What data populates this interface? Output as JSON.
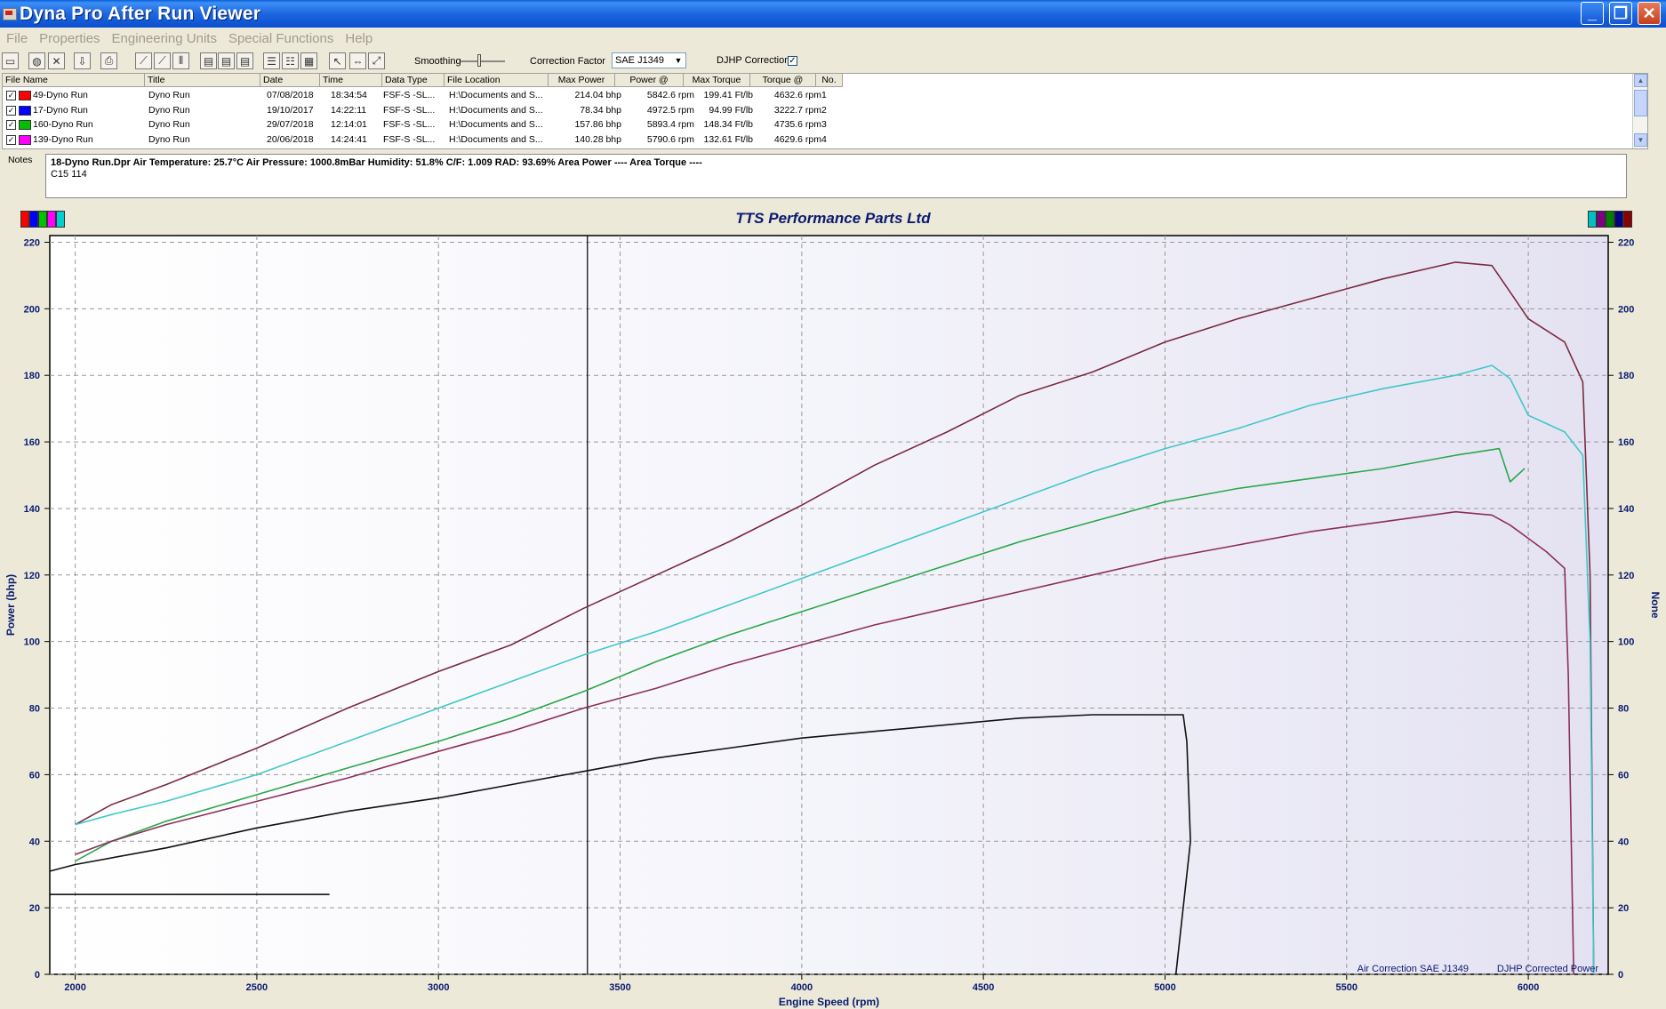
{
  "window": {
    "title": "Dyna Pro After Run Viewer",
    "minimize_glyph": "_",
    "maximize_glyph": "❐",
    "close_glyph": "✕"
  },
  "menu": [
    "File",
    "Properties",
    "Engineering Units",
    "Special Functions",
    "Help"
  ],
  "toolbar": {
    "smoothing_label": "Smoothing",
    "correction_factor_label": "Correction Factor",
    "correction_factor_value": "SAE J1349",
    "djhp_label": "DJHP Correction",
    "djhp_checked": "✓",
    "icons": [
      "open-icon",
      "globe-icon",
      "close-file-icon",
      "export-icon",
      "print-icon",
      "graph-icon",
      "graph-zoom-icon",
      "graph-compare-icon",
      "chart-icon",
      "chart-add-icon",
      "chart-settings-icon",
      "table-icon",
      "table-alt-icon",
      "table-grid-icon",
      "cursor-icon",
      "zoom-icon",
      "fit-icon"
    ],
    "icon_glyphs": [
      "▭",
      "◍",
      "✕",
      "⇩",
      "⎙",
      "⟋",
      "⟋",
      "⫴",
      "▤",
      "▤",
      "▤",
      "☰",
      "☷",
      "▦",
      "↖",
      "⇔",
      "⤢"
    ]
  },
  "file_table": {
    "headers": [
      "File Name",
      "Title",
      "Date",
      "Time",
      "Data Type",
      "File Location",
      "Max Power",
      "Power @",
      "Max Torque",
      "Torque @",
      "No."
    ],
    "check_glyph": "✓",
    "rows": [
      {
        "color": "#ff0000",
        "file": "49-Dyno Run",
        "title": "Dyno Run",
        "date": "07/08/2018",
        "time": "18:34:54",
        "type": "FSF-S -SL...",
        "location": "H:\\Documents and S...",
        "max_power": "214.04 bhp",
        "power_at": "5842.6 rpm",
        "max_torque": "199.41 Ft/lb",
        "torque_at": "4632.6 rpm",
        "no": "1"
      },
      {
        "color": "#0000ff",
        "file": "17-Dyno Run",
        "title": "Dyno Run",
        "date": "19/10/2017",
        "time": "14:22:11",
        "type": "FSF-S -SL...",
        "location": "H:\\Documents and S...",
        "max_power": "78.34 bhp",
        "power_at": "4972.5 rpm",
        "max_torque": "94.99 Ft/lb",
        "torque_at": "3222.7 rpm",
        "no": "2"
      },
      {
        "color": "#00c000",
        "file": "160-Dyno Run",
        "title": "Dyno Run",
        "date": "29/07/2018",
        "time": "12:14:01",
        "type": "FSF-S -SL...",
        "location": "H:\\Documents and S...",
        "max_power": "157.86 bhp",
        "power_at": "5893.4 rpm",
        "max_torque": "148.34 Ft/lb",
        "torque_at": "4735.6 rpm",
        "no": "3"
      },
      {
        "color": "#ff00ff",
        "file": "139-Dyno Run",
        "title": "Dyno Run",
        "date": "20/06/2018",
        "time": "14:24:41",
        "type": "FSF-S -SL...",
        "location": "H:\\Documents and S...",
        "max_power": "140.28 bhp",
        "power_at": "5790.6 rpm",
        "max_torque": "132.61 Ft/lb",
        "torque_at": "4629.6 rpm",
        "no": "4"
      }
    ]
  },
  "notes": {
    "label": "Notes",
    "line1": "18-Dyno Run.Dpr   Air Temperature: 25.7°C    Air Pressure: 1000.8mBar    Humidity: 51.8%    C/F: 1.009    RAD: 93.69%   Area Power ----    Area Torque ----",
    "line2": "C15 114"
  },
  "legend_swatches_left": [
    "#ff0000",
    "#0000ff",
    "#00c000",
    "#ff00ff",
    "#00d0d0"
  ],
  "legend_swatches_right": [
    "#00c0c0",
    "#800080",
    "#008000",
    "#000080",
    "#8b0000"
  ],
  "chart_data": {
    "type": "line",
    "title": "TTS Performance Parts Ltd",
    "xlabel": "Engine Speed (rpm)",
    "ylabel": "Power (bhp)",
    "ylabel_right": "None",
    "footer_left": "Air Correction SAE J1349",
    "footer_right": "DJHP Corrected Power",
    "xlim": [
      1930,
      6220
    ],
    "ylim": [
      0,
      222
    ],
    "xticks": [
      2000,
      2500,
      3000,
      3500,
      4000,
      4500,
      5000,
      5500,
      6000
    ],
    "yticks": [
      0,
      20,
      40,
      60,
      80,
      100,
      120,
      140,
      160,
      180,
      200,
      220
    ],
    "grid": true,
    "cursor_x": 3410,
    "reference_line": {
      "x": [
        1930,
        2700
      ],
      "y": 24
    },
    "series": [
      {
        "color": "#7a2b3f",
        "x": [
          2000,
          2100,
          2250,
          2500,
          2750,
          3000,
          3200,
          3400,
          3600,
          3800,
          4000,
          4200,
          4400,
          4600,
          4800,
          5000,
          5200,
          5400,
          5600,
          5800,
          5900,
          5950,
          6000,
          6100,
          6150,
          6170,
          6180
        ],
        "y": [
          45,
          51,
          57,
          68,
          80,
          91,
          99,
          110,
          120,
          130,
          141,
          153,
          163,
          174,
          181,
          190,
          197,
          203,
          209,
          214,
          213,
          205,
          197,
          190,
          178,
          120,
          0
        ]
      },
      {
        "color": "#40c8c8",
        "x": [
          2000,
          2100,
          2250,
          2500,
          2750,
          3000,
          3200,
          3400,
          3600,
          3800,
          4000,
          4200,
          4400,
          4600,
          4800,
          5000,
          5200,
          5400,
          5600,
          5800,
          5900,
          5950,
          6000,
          6100,
          6150,
          6170,
          6180
        ],
        "y": [
          45,
          48,
          52,
          60,
          70,
          80,
          88,
          96,
          103,
          111,
          119,
          127,
          135,
          143,
          151,
          158,
          164,
          171,
          176,
          180,
          183,
          179,
          168,
          163,
          156,
          100,
          0
        ]
      },
      {
        "color": "#2aa84a",
        "x": [
          2000,
          2100,
          2250,
          2500,
          2750,
          3000,
          3200,
          3400,
          3600,
          3800,
          4000,
          4200,
          4400,
          4600,
          4800,
          5000,
          5200,
          5400,
          5600,
          5800,
          5920,
          5950,
          5990
        ],
        "y": [
          34,
          40,
          46,
          54,
          62,
          70,
          77,
          85,
          94,
          102,
          109,
          116,
          123,
          130,
          136,
          142,
          146,
          149,
          152,
          156,
          158,
          148,
          152
        ]
      },
      {
        "color": "#8b2f5a",
        "x": [
          2000,
          2100,
          2250,
          2500,
          2750,
          3000,
          3200,
          3400,
          3600,
          3800,
          4000,
          4200,
          4400,
          4600,
          4800,
          5000,
          5200,
          5400,
          5600,
          5800,
          5900,
          5950,
          6000,
          6050,
          6100,
          6110,
          6120,
          6125
        ],
        "y": [
          36,
          40,
          45,
          52,
          59,
          67,
          73,
          80,
          86,
          93,
          99,
          105,
          110,
          115,
          120,
          125,
          129,
          133,
          136,
          139,
          138,
          135,
          131,
          127,
          122,
          90,
          30,
          0
        ]
      },
      {
        "color": "#111111",
        "x": [
          1930,
          2000,
          2250,
          2500,
          2750,
          3000,
          3200,
          3400,
          3600,
          3800,
          4000,
          4200,
          4400,
          4600,
          4800,
          5000,
          5050,
          5060,
          5070,
          5040,
          5030
        ],
        "y": [
          31,
          33,
          38,
          44,
          49,
          53,
          57,
          61,
          65,
          68,
          71,
          73,
          75,
          77,
          78,
          78,
          78,
          70,
          40,
          10,
          0
        ]
      }
    ]
  }
}
